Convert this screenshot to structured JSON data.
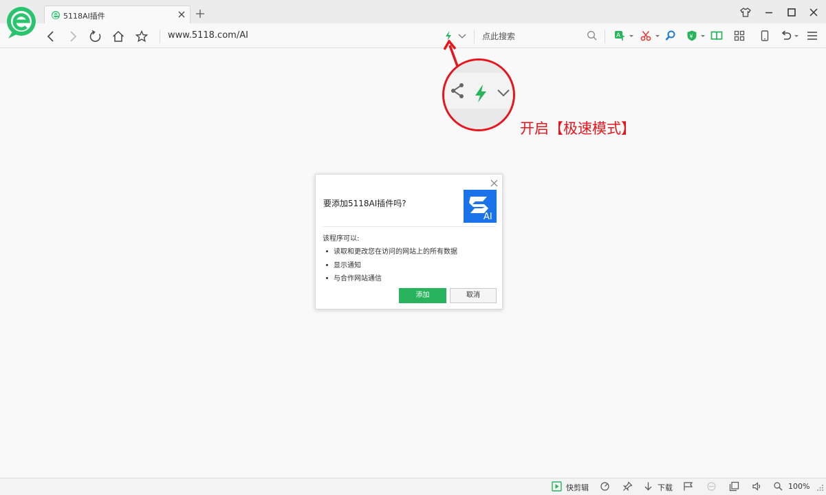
{
  "colors": {
    "accent_green": "#27b45c",
    "annotation_red": "#e8141c",
    "logo_blue": "#1a73e8"
  },
  "tab": {
    "title": "5118AI插件",
    "icon": "ie-leaf-icon"
  },
  "address_bar": {
    "url": "www.5118.com/AI"
  },
  "search": {
    "placeholder": "点此搜索"
  },
  "annotation": {
    "text": "开启【极速模式】"
  },
  "dialog": {
    "title": "要添加5118AI插件吗?",
    "subtitle": "该程序可以:",
    "permissions": [
      "读取和更改您在访问的网站上的所有数据",
      "显示通知",
      "与合作网站通信"
    ],
    "add_label": "添加",
    "cancel_label": "取消",
    "logo_text": "AI"
  },
  "statusbar": {
    "quick_clip_label": "快剪辑",
    "download_label": "下载",
    "zoom": "100%"
  }
}
